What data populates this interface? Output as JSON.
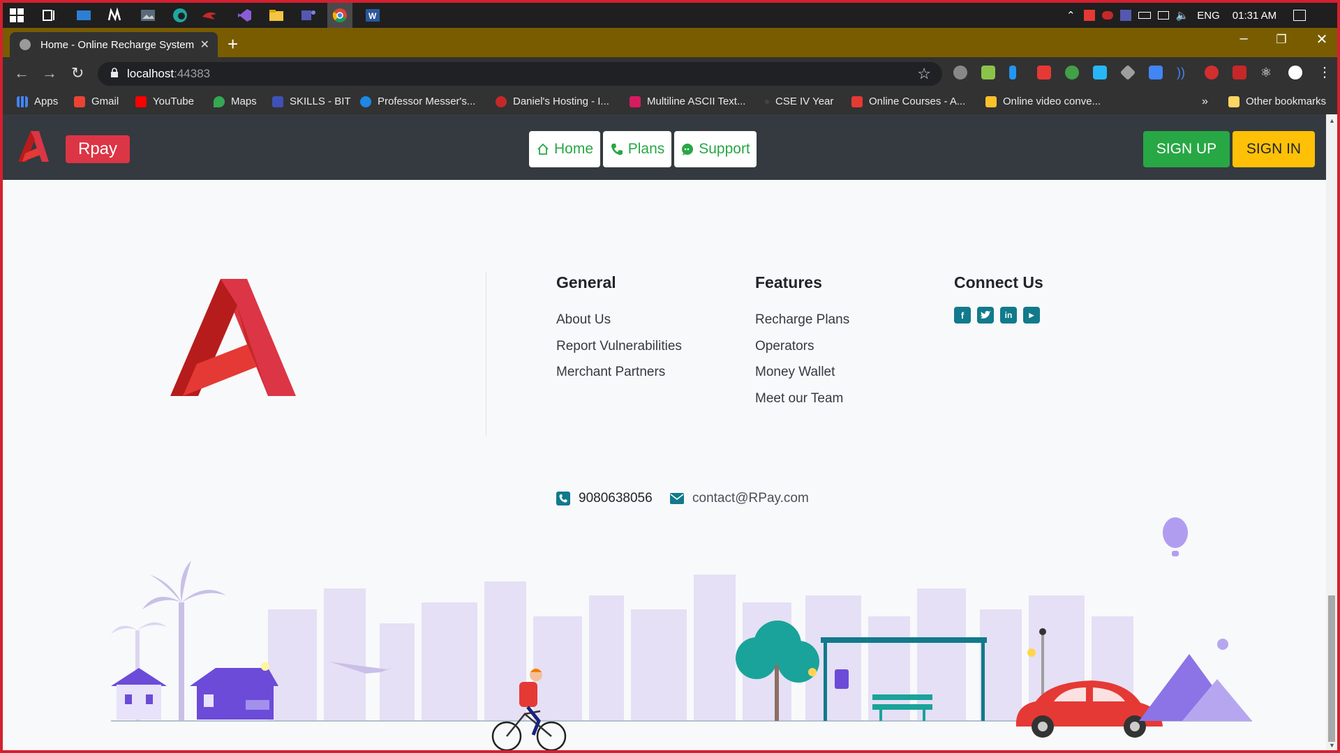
{
  "taskbar": {
    "language": "ENG",
    "time": "01:31 AM"
  },
  "browser": {
    "tab_title": "Home - Online Recharge System",
    "url_host": "localhost",
    "url_port": ":44383",
    "bookmarks": [
      {
        "label": "Apps",
        "color": "#4285f4"
      },
      {
        "label": "Gmail",
        "color": "#ea4335"
      },
      {
        "label": "YouTube",
        "color": "#ff0000"
      },
      {
        "label": "Maps",
        "color": "#34a853"
      },
      {
        "label": "SKILLS - BIT",
        "color": "#3f51b5"
      },
      {
        "label": "Professor Messer's...",
        "color": "#1e88e5"
      },
      {
        "label": "Daniel's Hosting - I...",
        "color": "#c62828"
      },
      {
        "label": "Multiline ASCII Text...",
        "color": "#d81b60"
      },
      {
        "label": "CSE IV Year",
        "color": "#323232"
      },
      {
        "label": "Online Courses - A...",
        "color": "#e53935"
      },
      {
        "label": "Online video conve...",
        "color": "#fbc02d"
      }
    ],
    "more_bookmarks": "»",
    "other_bookmarks": "Other bookmarks"
  },
  "site": {
    "brand": "Rpay",
    "nav": [
      {
        "label": "Home",
        "icon": "home-icon"
      },
      {
        "label": "Plans",
        "icon": "phone-icon"
      },
      {
        "label": "Support",
        "icon": "chat-icon"
      }
    ],
    "sign_up": "SIGN UP",
    "sign_in": "SIGN IN",
    "colors": {
      "navbar": "#343a40",
      "brand_red": "#dc3545",
      "green": "#28a745",
      "yellow": "#ffc107",
      "teal": "#117a8b"
    }
  },
  "footer": {
    "general": {
      "title": "General",
      "links": [
        "About Us",
        "Report Vulnerabilities",
        "Merchant Partners"
      ]
    },
    "features": {
      "title": "Features",
      "links": [
        "Recharge Plans",
        "Operators",
        "Money Wallet",
        "Meet our Team"
      ]
    },
    "connect": {
      "title": "Connect Us",
      "socials": [
        "facebook-icon",
        "twitter-icon",
        "linkedin-icon",
        "youtube-icon"
      ]
    },
    "phone": "9080638056",
    "email": "contact@RPay.com"
  }
}
